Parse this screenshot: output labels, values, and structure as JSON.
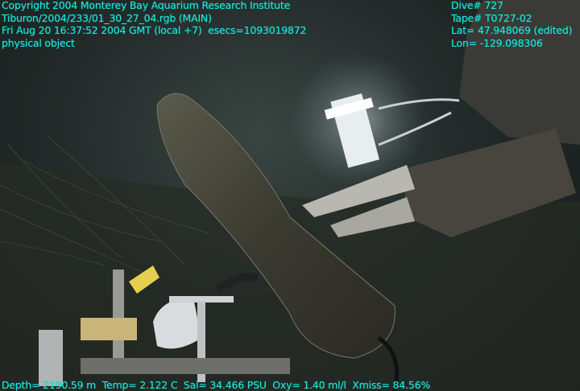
{
  "overlay": {
    "top_left": [
      "Copyright 2004 Monterey Bay Aquarium Research Institute",
      "Tiburon/2004/233/01_30_27_04.rgb (MAIN)",
      "Fri Aug 20 16:37:52 2004 GMT (local +7)  esecs=1093019872",
      "physical object"
    ],
    "top_right": [
      "Dive# 727",
      "Tape# T0727-02",
      "Lat= 47.948069 (edited)",
      "Lon= -129.098306"
    ],
    "bottom": "Depth= 2190.59 m  Temp= 2.122 C  Sal= 34.466 PSU  Oxy= 1.40 ml/l  Xmiss= 84.56%"
  },
  "colors": {
    "overlay_text": "#1ee3e8"
  }
}
